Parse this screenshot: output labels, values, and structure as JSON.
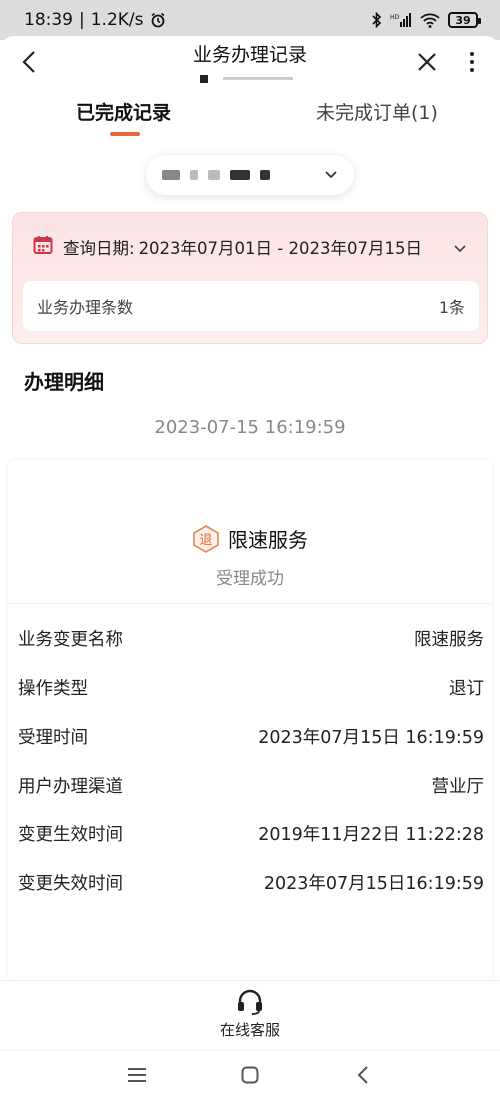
{
  "status_bar": {
    "time": "18:39",
    "speed": "1.2K/s",
    "battery": "39"
  },
  "header": {
    "title": "业务办理记录"
  },
  "tabs": [
    {
      "label": "已完成记录",
      "active": true
    },
    {
      "label": "未完成订单(1)",
      "active": false
    }
  ],
  "query": {
    "label": "查询日期:",
    "value": "2023年07月01日 - 2023年07月15日",
    "count_label": "业务办理条数",
    "count_value": "1条"
  },
  "section": {
    "title": "办理明细",
    "time": "2023-07-15 16:19:59"
  },
  "service": {
    "icon_text": "退",
    "name": "限速服务",
    "status": "受理成功",
    "details": [
      {
        "label": "业务变更名称",
        "value": "限速服务"
      },
      {
        "label": "操作类型",
        "value": "退订"
      },
      {
        "label": "受理时间",
        "value": "2023年07月15日 16:19:59"
      },
      {
        "label": "用户办理渠道",
        "value": "营业厅"
      },
      {
        "label": "变更生效时间",
        "value": "2019年11月22日 11:22:28"
      },
      {
        "label": "变更失效时间",
        "value": "2023年07月15日16:19:59"
      }
    ]
  },
  "bottom": {
    "service_label": "在线客服"
  },
  "colors": {
    "accent": "#e8673a",
    "query_bg": "#fbe3e4",
    "calendar": "#d6334a"
  }
}
